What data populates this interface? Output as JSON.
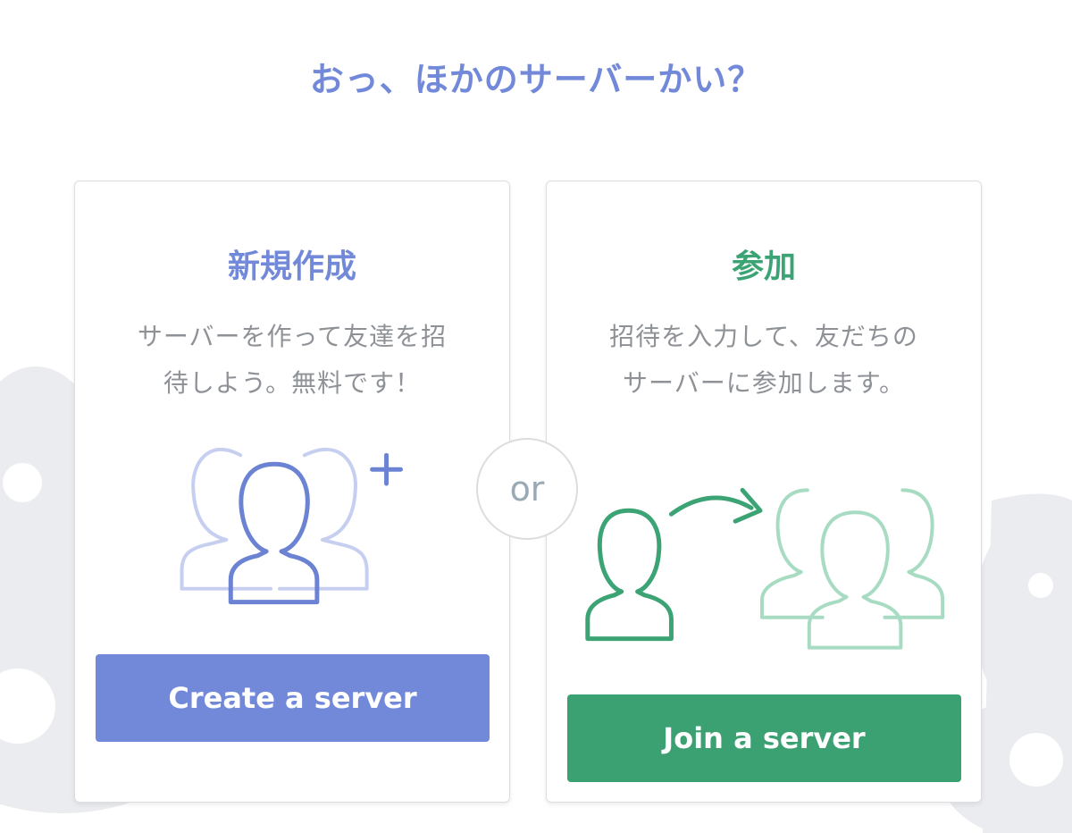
{
  "page": {
    "title": "おっ、ほかのサーバーかい？"
  },
  "create": {
    "heading": "新規作成",
    "description": "サーバーを作って友達を招待しよう。無料です！",
    "button_label": "Create a server",
    "accent_color": "#7289da"
  },
  "join": {
    "heading": "参加",
    "description": "招待を入力して、友だちのサーバーに参加します。",
    "button_label": "Join a server",
    "accent_color": "#3ca374"
  },
  "divider": {
    "label": "or"
  },
  "icons": {
    "create_illustration": "group-add-icon",
    "join_illustration": "join-group-icon"
  }
}
